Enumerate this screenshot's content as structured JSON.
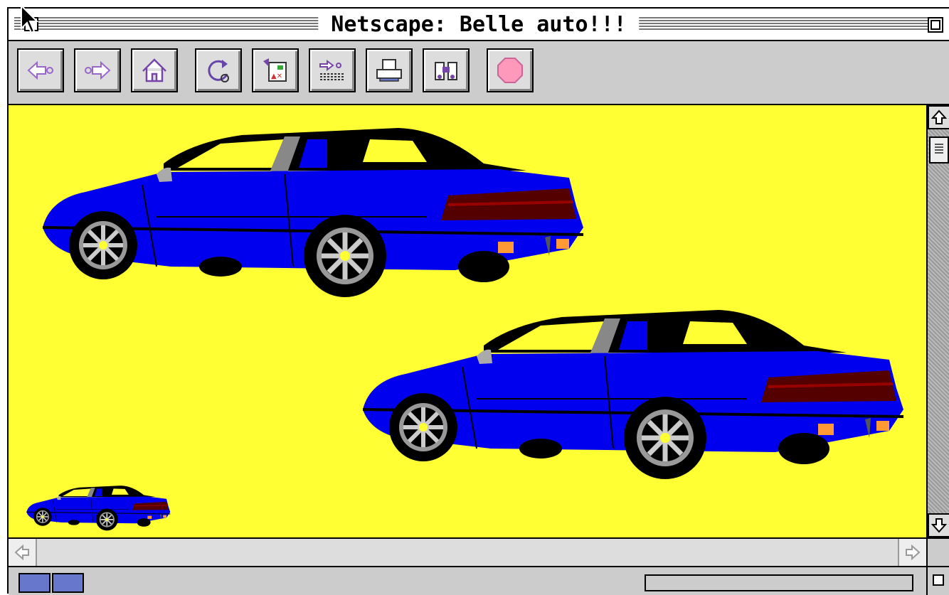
{
  "window": {
    "title": "Netscape: Belle auto!!!"
  },
  "toolbar": {
    "buttons": [
      {
        "name": "back-button",
        "icon": "back-arrow-icon"
      },
      {
        "name": "forward-button",
        "icon": "forward-arrow-icon"
      },
      {
        "name": "home-button",
        "icon": "home-icon"
      },
      {
        "name": "reload-button",
        "icon": "reload-icon"
      },
      {
        "name": "images-button",
        "icon": "images-icon"
      },
      {
        "name": "open-button",
        "icon": "open-location-icon"
      },
      {
        "name": "print-button",
        "icon": "printer-icon"
      },
      {
        "name": "find-button",
        "icon": "binoculars-icon"
      },
      {
        "name": "stop-button",
        "icon": "stop-icon"
      }
    ]
  },
  "content": {
    "background_color": "#ffff33",
    "images": [
      {
        "name": "car-image-large-top",
        "description_icon": "blue-coupe-car"
      },
      {
        "name": "car-image-large-bottom",
        "description_icon": "blue-coupe-car"
      },
      {
        "name": "car-image-thumbnail",
        "description_icon": "blue-coupe-car"
      }
    ]
  },
  "colors": {
    "car_body": "#0000ee",
    "page_background": "#ffff33",
    "chrome_gray": "#cccccc"
  },
  "statusbar": {
    "security_icon": "security-key-icon"
  }
}
